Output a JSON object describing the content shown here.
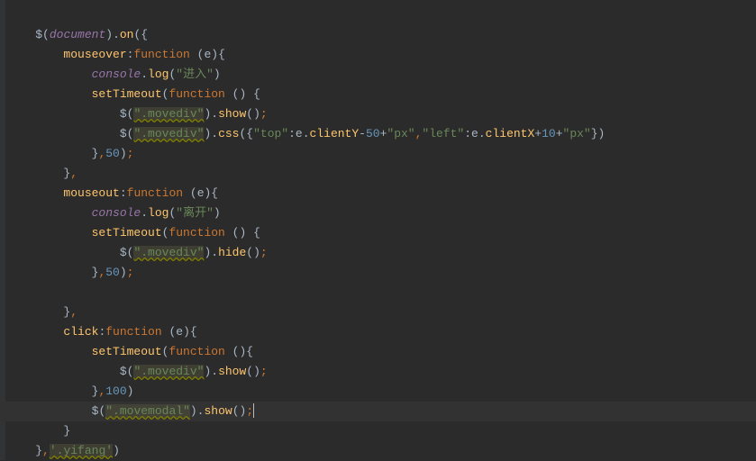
{
  "code": {
    "l1_dollar": "$",
    "l1_document": "document",
    "l1_on": "on",
    "l2_mouseover": "mouseover",
    "l2_function": "function",
    "l2_e": "e",
    "l3_console": "console",
    "l3_log": "log",
    "l3_str": "\"进入\"",
    "l4_setTimeout": "setTimeout",
    "l4_function": "function",
    "l5_str": "\".movediv\"",
    "l5_show": "show",
    "l6_str": "\".movediv\"",
    "l6_css": "css",
    "l6_top": "\"top\"",
    "l6_e1": "e",
    "l6_clientY": "clientY",
    "l6_50": "50",
    "l6_px1": "\"px\"",
    "l6_left": "\"left\"",
    "l6_e2": "e",
    "l6_clientX": "clientX",
    "l6_10": "10",
    "l6_px2": "\"px\"",
    "l7_50": "50",
    "l10_mouseout": "mouseout",
    "l10_function": "function",
    "l10_e": "e",
    "l11_console": "console",
    "l11_log": "log",
    "l11_str": "\"离开\"",
    "l12_setTimeout": "setTimeout",
    "l12_function": "function",
    "l13_str": "\".movediv\"",
    "l13_hide": "hide",
    "l14_50": "50",
    "l17_click": "click",
    "l17_function": "function",
    "l17_e": "e",
    "l18_setTimeout": "setTimeout",
    "l18_function": "function",
    "l19_str": "\".movediv\"",
    "l19_show": "show",
    "l20_100": "100",
    "l21_str": "\".movemodal\"",
    "l21_show": "show",
    "l23_str": "'.yifang'"
  }
}
